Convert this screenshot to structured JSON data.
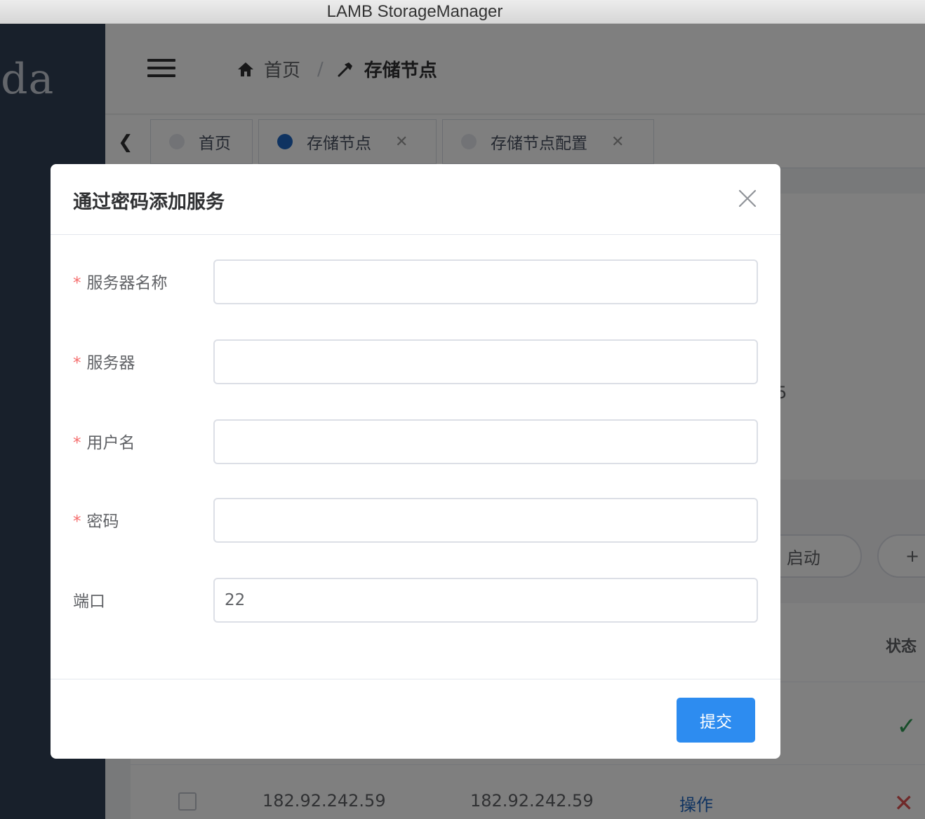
{
  "window": {
    "title": "LAMB StorageManager"
  },
  "sidebar": {
    "logo_text": "oda"
  },
  "navbar": {
    "breadcrumb": [
      {
        "label": "首页",
        "icon": "home-icon"
      },
      {
        "label": "存储节点",
        "icon": "hammer-icon"
      }
    ]
  },
  "tags": [
    {
      "label": "首页",
      "active": false,
      "closable": false
    },
    {
      "label": "存储节点",
      "active": true,
      "closable": true
    },
    {
      "label": "存储节点配置",
      "active": false,
      "closable": true
    }
  ],
  "background": {
    "partial_text": "5",
    "buttons": {
      "start": "启动",
      "add": "+"
    },
    "table": {
      "status_header": "状态",
      "row": {
        "col1": "182.92.242.59",
        "col2": "182.92.242.59",
        "action": "操作"
      }
    }
  },
  "dialog": {
    "title": "通过密码添加服务",
    "fields": [
      {
        "label": "服务器名称",
        "required": true,
        "value": ""
      },
      {
        "label": "服务器",
        "required": true,
        "value": ""
      },
      {
        "label": "用户名",
        "required": true,
        "value": ""
      },
      {
        "label": "密码",
        "required": true,
        "value": ""
      },
      {
        "label": "端口",
        "required": false,
        "value": "22"
      }
    ],
    "submit_label": "提交",
    "required_mark": "*"
  },
  "colors": {
    "primary": "#2d8cf0",
    "required": "#f56c6c",
    "sidebar": "#304156"
  }
}
